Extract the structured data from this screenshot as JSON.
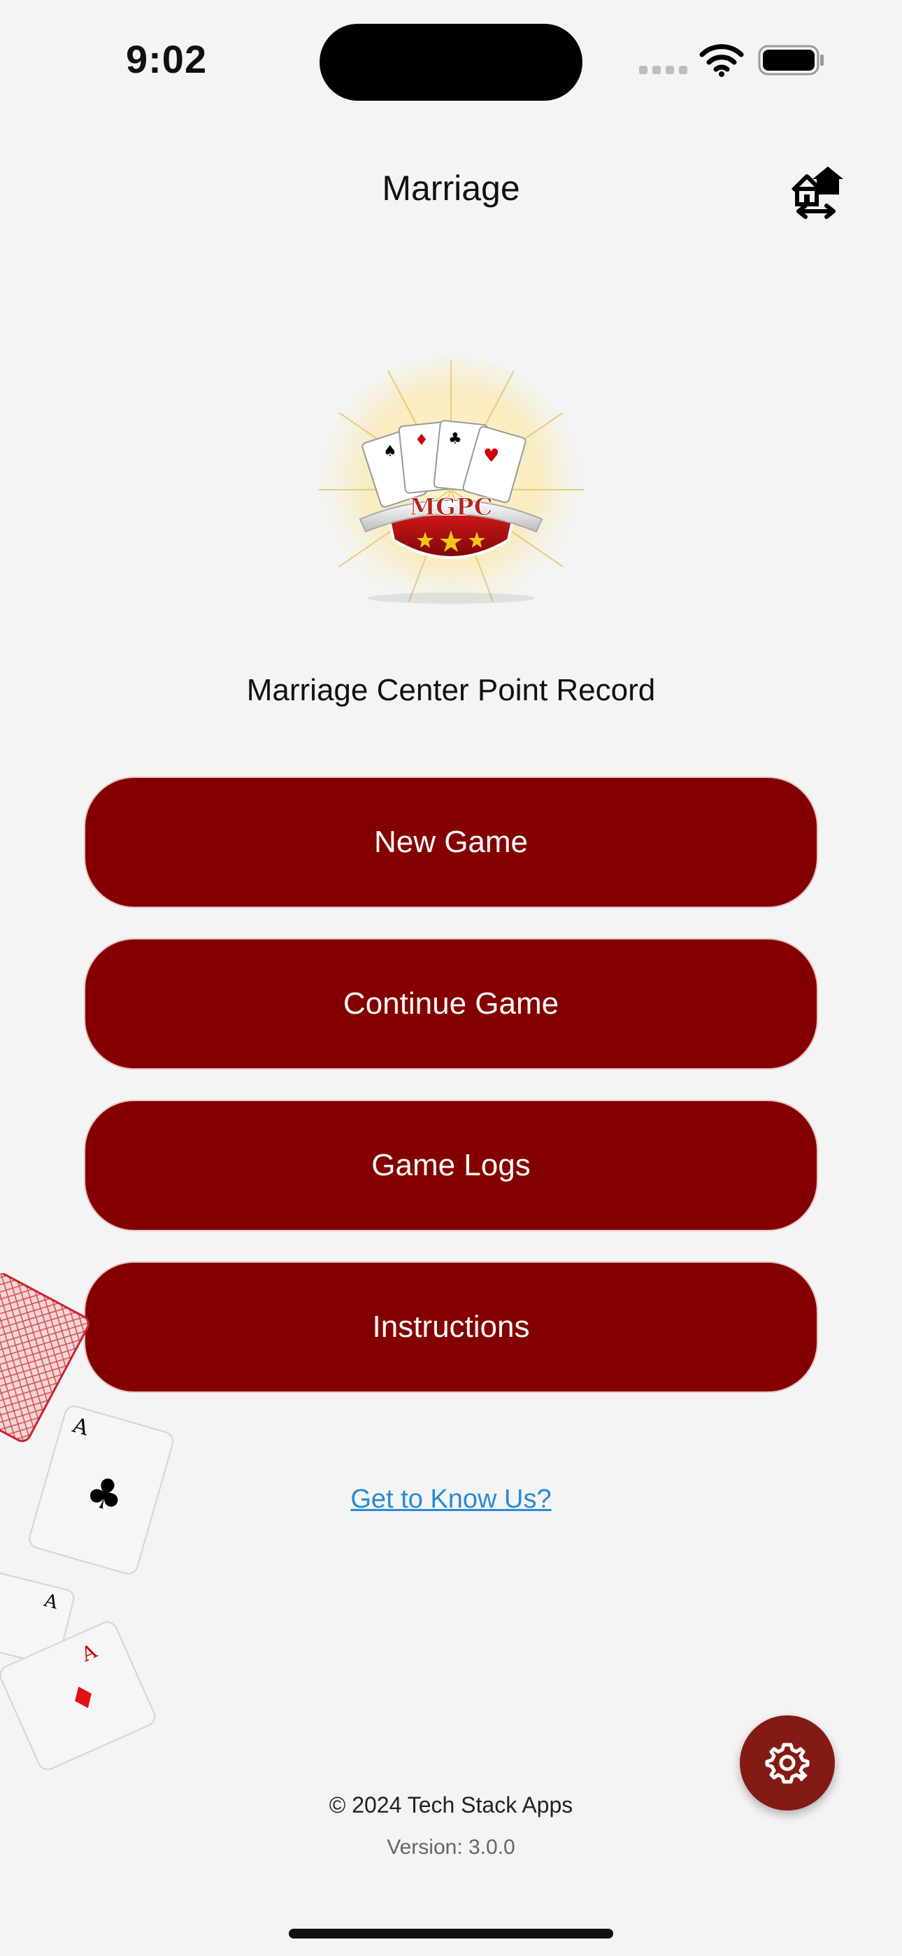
{
  "status": {
    "time": "9:02"
  },
  "nav": {
    "title": "Marriage",
    "switch_icon": "house-swap-icon"
  },
  "logo": {
    "text": "MGPC"
  },
  "subtitle": "Marriage Center Point Record",
  "buttons": {
    "new_game": "New Game",
    "continue_game": "Continue Game",
    "game_logs": "Game Logs",
    "instructions": "Instructions"
  },
  "about_link": "Get to Know Us?",
  "fab": {
    "icon": "gear-icon"
  },
  "footer": {
    "copyright": "© 2024 Tech Stack Apps",
    "version": "Version: 3.0.0"
  },
  "colors": {
    "primary": "#840000",
    "fab": "#841A14",
    "link": "#2A8AD6",
    "background": "#F4F4F4"
  }
}
